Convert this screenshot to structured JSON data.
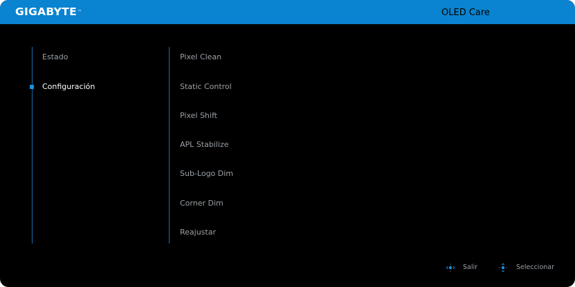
{
  "header": {
    "brand": "GIGABYTE",
    "trademark": "™",
    "title": "OLED Care",
    "accent_color": "#0a84d0"
  },
  "sidebar": {
    "items": [
      {
        "label": "Estado",
        "active": false
      },
      {
        "label": "Configuración",
        "active": true
      }
    ]
  },
  "options": {
    "items": [
      {
        "label": "Pixel Clean"
      },
      {
        "label": "Static Control"
      },
      {
        "label": "Pixel Shift"
      },
      {
        "label": "APL Stabilize"
      },
      {
        "label": "Sub-Logo Dim"
      },
      {
        "label": "Corner Dim"
      },
      {
        "label": "Reajustar"
      }
    ]
  },
  "footer": {
    "hints": [
      {
        "icon": "joystick-left-right-icon",
        "label": "Salir"
      },
      {
        "icon": "joystick-up-down-icon",
        "label": "Seleccionar"
      }
    ]
  }
}
